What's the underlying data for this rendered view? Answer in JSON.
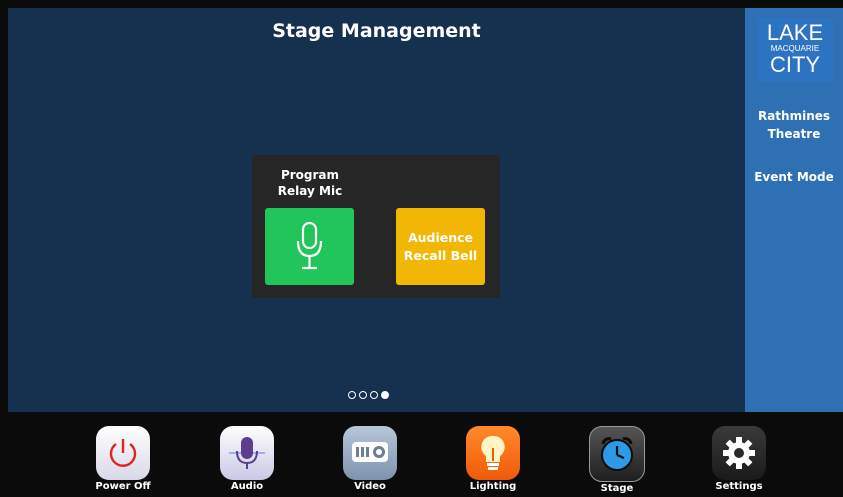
{
  "header": {
    "title": "Stage Management"
  },
  "panel": {
    "label": "Program Relay Mic",
    "mic_icon": "microphone-icon",
    "bell_button_label": "Audience Recall Bell"
  },
  "pager": {
    "pages": 4,
    "active": 4
  },
  "sidebar": {
    "logo": {
      "line1": "LAKE",
      "line2": "MACQUARIE",
      "line3": "CITY"
    },
    "venue": "Rathmines Theatre",
    "mode": "Event Mode"
  },
  "nav": [
    {
      "label": "Power Off",
      "icon": "power-icon"
    },
    {
      "label": "Audio",
      "icon": "microphone-icon"
    },
    {
      "label": "Video",
      "icon": "projector-icon"
    },
    {
      "label": "Lighting",
      "icon": "lightbulb-icon"
    },
    {
      "label": "Stage",
      "icon": "alarm-clock-icon"
    },
    {
      "label": "Settings",
      "icon": "gear-icon"
    }
  ],
  "colors": {
    "background": "#16304f",
    "sidebar": "#2f6fb3",
    "mic_button": "#22c55a",
    "bell_button": "#f2b705"
  }
}
